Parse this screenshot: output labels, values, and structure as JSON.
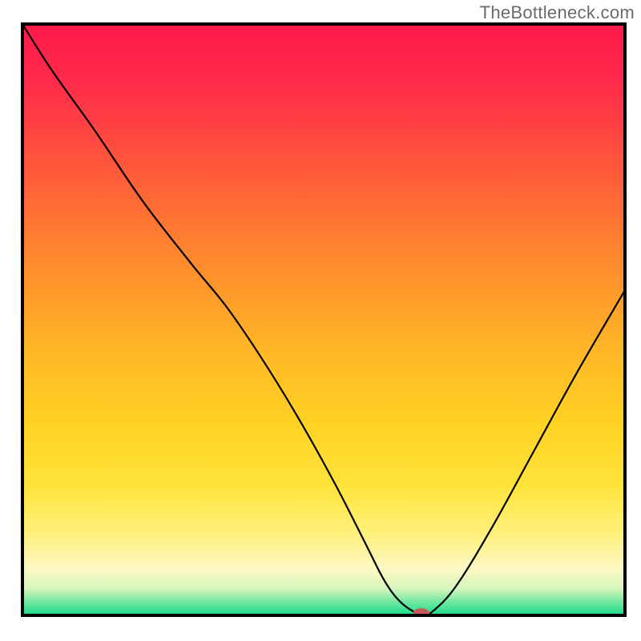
{
  "watermark": "TheBottleneck.com",
  "chart_data": {
    "type": "line",
    "title": "",
    "xlabel": "",
    "ylabel": "",
    "xlim": [
      0,
      100
    ],
    "ylim": [
      0,
      100
    ],
    "grid": false,
    "legend": false,
    "background_gradient_stops": [
      {
        "offset": 0.0,
        "color": "#ff1a4b"
      },
      {
        "offset": 0.1,
        "color": "#ff2b4a"
      },
      {
        "offset": 0.25,
        "color": "#ff5a3a"
      },
      {
        "offset": 0.4,
        "color": "#ff8a2e"
      },
      {
        "offset": 0.55,
        "color": "#ffb626"
      },
      {
        "offset": 0.68,
        "color": "#ffd324"
      },
      {
        "offset": 0.78,
        "color": "#ffe33a"
      },
      {
        "offset": 0.86,
        "color": "#fff07a"
      },
      {
        "offset": 0.92,
        "color": "#fdf8c2"
      },
      {
        "offset": 0.955,
        "color": "#d6f6bd"
      },
      {
        "offset": 0.975,
        "color": "#7ae9a2"
      },
      {
        "offset": 1.0,
        "color": "#19da8a"
      }
    ],
    "series": [
      {
        "name": "bottleneck-curve",
        "x": [
          0.0,
          5.0,
          12.0,
          20.0,
          28.0,
          34.0,
          40.0,
          46.0,
          52.0,
          57.0,
          60.0,
          62.5,
          65.0,
          66.5,
          68.0,
          72.0,
          78.0,
          85.0,
          92.0,
          100.0
        ],
        "y": [
          100.0,
          92.0,
          82.0,
          70.0,
          59.5,
          52.0,
          43.0,
          33.0,
          22.0,
          12.0,
          6.0,
          2.5,
          0.6,
          0.3,
          0.6,
          5.0,
          15.0,
          28.0,
          41.0,
          55.0
        ]
      }
    ],
    "minimum_marker": {
      "x": 66.2,
      "y": 0.3,
      "rx": 1.4,
      "ry": 0.9,
      "color": "#c65a5a"
    },
    "plot_border_color": "#000000",
    "plot_border_width": 4,
    "curve_color": "#000000",
    "curve_width": 2.2
  }
}
